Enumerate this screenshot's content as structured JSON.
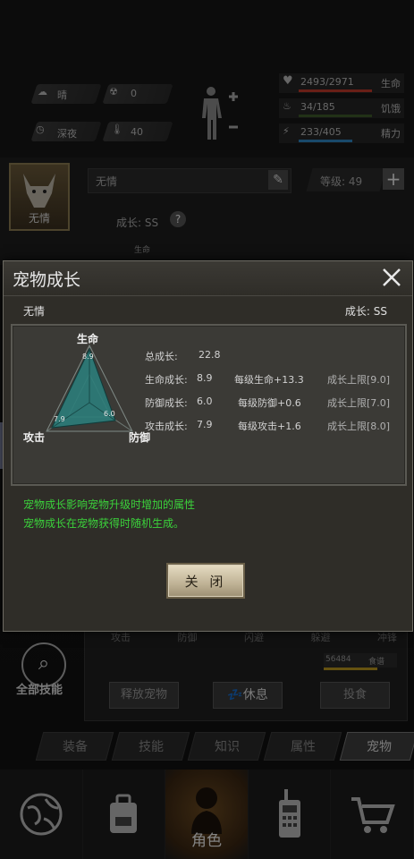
{
  "hud": {
    "weather": "晴",
    "radiation": "0",
    "time_of_day": "深夜",
    "temperature": "40",
    "hp": "2493/2971",
    "hp_label": "生命",
    "hunger": "34/185",
    "hunger_label": "饥饿",
    "energy": "233/405",
    "energy_label": "精力"
  },
  "pet_panel": {
    "avatar_name": "无情",
    "name_value": "无情",
    "level_label": "等级: 49",
    "growth_label": "成长: SS",
    "life_mini": "生命",
    "actions_row": [
      "攻击",
      "防御",
      "闪避",
      "躲避",
      "冲锋"
    ],
    "exp_value": "56484",
    "food_label": "食谱",
    "all_skills": "全部技能",
    "release_btn": "释放宠物",
    "rest_btn": "休息",
    "feed_btn": "投食"
  },
  "tabs": [
    {
      "label": "装备"
    },
    {
      "label": "技能"
    },
    {
      "label": "知识"
    },
    {
      "label": "属性"
    },
    {
      "label": "宠物"
    }
  ],
  "bottom_nav": {
    "role_label": "角色"
  },
  "modal": {
    "title": "宠物成长",
    "pet_name": "无情",
    "growth_rank": "成长: SS",
    "radar": {
      "life_label": "生命",
      "attack_label": "攻击",
      "defense_label": "防御",
      "life_value": "8.9",
      "attack_value": "7.9",
      "defense_value": "6.0"
    },
    "total_growth_label": "总成长:",
    "total_growth_value": "22.8",
    "rows": [
      {
        "label": "生命成长:",
        "value": "8.9",
        "per_level": "每级生命+13.3",
        "cap": "成长上限[9.0]"
      },
      {
        "label": "防御成长:",
        "value": "6.0",
        "per_level": "每级防御+0.6",
        "cap": "成长上限[7.0]"
      },
      {
        "label": "攻击成长:",
        "value": "7.9",
        "per_level": "每级攻击+1.6",
        "cap": "成长上限[8.0]"
      }
    ],
    "notes": [
      "宠物成长影响宠物升级时增加的属性",
      "宠物成长在宠物获得时随机生成。"
    ],
    "close_button": "关 闭",
    "colors": {
      "note_green": "#3bd23b",
      "hp_bar": "#c0392b",
      "hunger_bar": "#2e86c1",
      "energy_bar": "#6c7a89"
    }
  }
}
